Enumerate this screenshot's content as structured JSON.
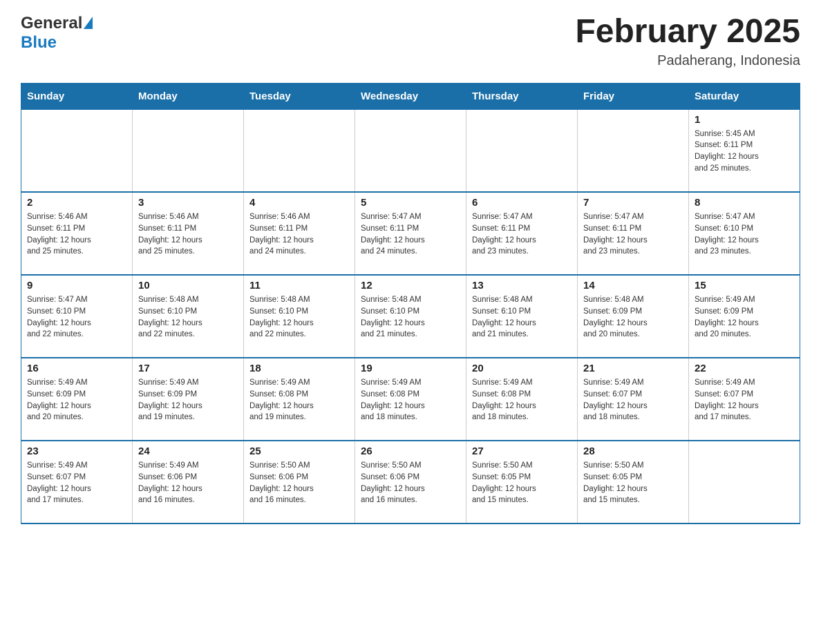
{
  "header": {
    "logo_general": "General",
    "logo_blue": "Blue",
    "month_title": "February 2025",
    "location": "Padaherang, Indonesia"
  },
  "days_of_week": [
    "Sunday",
    "Monday",
    "Tuesday",
    "Wednesday",
    "Thursday",
    "Friday",
    "Saturday"
  ],
  "weeks": [
    [
      {
        "day": "",
        "info": ""
      },
      {
        "day": "",
        "info": ""
      },
      {
        "day": "",
        "info": ""
      },
      {
        "day": "",
        "info": ""
      },
      {
        "day": "",
        "info": ""
      },
      {
        "day": "",
        "info": ""
      },
      {
        "day": "1",
        "info": "Sunrise: 5:45 AM\nSunset: 6:11 PM\nDaylight: 12 hours\nand 25 minutes."
      }
    ],
    [
      {
        "day": "2",
        "info": "Sunrise: 5:46 AM\nSunset: 6:11 PM\nDaylight: 12 hours\nand 25 minutes."
      },
      {
        "day": "3",
        "info": "Sunrise: 5:46 AM\nSunset: 6:11 PM\nDaylight: 12 hours\nand 25 minutes."
      },
      {
        "day": "4",
        "info": "Sunrise: 5:46 AM\nSunset: 6:11 PM\nDaylight: 12 hours\nand 24 minutes."
      },
      {
        "day": "5",
        "info": "Sunrise: 5:47 AM\nSunset: 6:11 PM\nDaylight: 12 hours\nand 24 minutes."
      },
      {
        "day": "6",
        "info": "Sunrise: 5:47 AM\nSunset: 6:11 PM\nDaylight: 12 hours\nand 23 minutes."
      },
      {
        "day": "7",
        "info": "Sunrise: 5:47 AM\nSunset: 6:11 PM\nDaylight: 12 hours\nand 23 minutes."
      },
      {
        "day": "8",
        "info": "Sunrise: 5:47 AM\nSunset: 6:10 PM\nDaylight: 12 hours\nand 23 minutes."
      }
    ],
    [
      {
        "day": "9",
        "info": "Sunrise: 5:47 AM\nSunset: 6:10 PM\nDaylight: 12 hours\nand 22 minutes."
      },
      {
        "day": "10",
        "info": "Sunrise: 5:48 AM\nSunset: 6:10 PM\nDaylight: 12 hours\nand 22 minutes."
      },
      {
        "day": "11",
        "info": "Sunrise: 5:48 AM\nSunset: 6:10 PM\nDaylight: 12 hours\nand 22 minutes."
      },
      {
        "day": "12",
        "info": "Sunrise: 5:48 AM\nSunset: 6:10 PM\nDaylight: 12 hours\nand 21 minutes."
      },
      {
        "day": "13",
        "info": "Sunrise: 5:48 AM\nSunset: 6:10 PM\nDaylight: 12 hours\nand 21 minutes."
      },
      {
        "day": "14",
        "info": "Sunrise: 5:48 AM\nSunset: 6:09 PM\nDaylight: 12 hours\nand 20 minutes."
      },
      {
        "day": "15",
        "info": "Sunrise: 5:49 AM\nSunset: 6:09 PM\nDaylight: 12 hours\nand 20 minutes."
      }
    ],
    [
      {
        "day": "16",
        "info": "Sunrise: 5:49 AM\nSunset: 6:09 PM\nDaylight: 12 hours\nand 20 minutes."
      },
      {
        "day": "17",
        "info": "Sunrise: 5:49 AM\nSunset: 6:09 PM\nDaylight: 12 hours\nand 19 minutes."
      },
      {
        "day": "18",
        "info": "Sunrise: 5:49 AM\nSunset: 6:08 PM\nDaylight: 12 hours\nand 19 minutes."
      },
      {
        "day": "19",
        "info": "Sunrise: 5:49 AM\nSunset: 6:08 PM\nDaylight: 12 hours\nand 18 minutes."
      },
      {
        "day": "20",
        "info": "Sunrise: 5:49 AM\nSunset: 6:08 PM\nDaylight: 12 hours\nand 18 minutes."
      },
      {
        "day": "21",
        "info": "Sunrise: 5:49 AM\nSunset: 6:07 PM\nDaylight: 12 hours\nand 18 minutes."
      },
      {
        "day": "22",
        "info": "Sunrise: 5:49 AM\nSunset: 6:07 PM\nDaylight: 12 hours\nand 17 minutes."
      }
    ],
    [
      {
        "day": "23",
        "info": "Sunrise: 5:49 AM\nSunset: 6:07 PM\nDaylight: 12 hours\nand 17 minutes."
      },
      {
        "day": "24",
        "info": "Sunrise: 5:49 AM\nSunset: 6:06 PM\nDaylight: 12 hours\nand 16 minutes."
      },
      {
        "day": "25",
        "info": "Sunrise: 5:50 AM\nSunset: 6:06 PM\nDaylight: 12 hours\nand 16 minutes."
      },
      {
        "day": "26",
        "info": "Sunrise: 5:50 AM\nSunset: 6:06 PM\nDaylight: 12 hours\nand 16 minutes."
      },
      {
        "day": "27",
        "info": "Sunrise: 5:50 AM\nSunset: 6:05 PM\nDaylight: 12 hours\nand 15 minutes."
      },
      {
        "day": "28",
        "info": "Sunrise: 5:50 AM\nSunset: 6:05 PM\nDaylight: 12 hours\nand 15 minutes."
      },
      {
        "day": "",
        "info": ""
      }
    ]
  ]
}
